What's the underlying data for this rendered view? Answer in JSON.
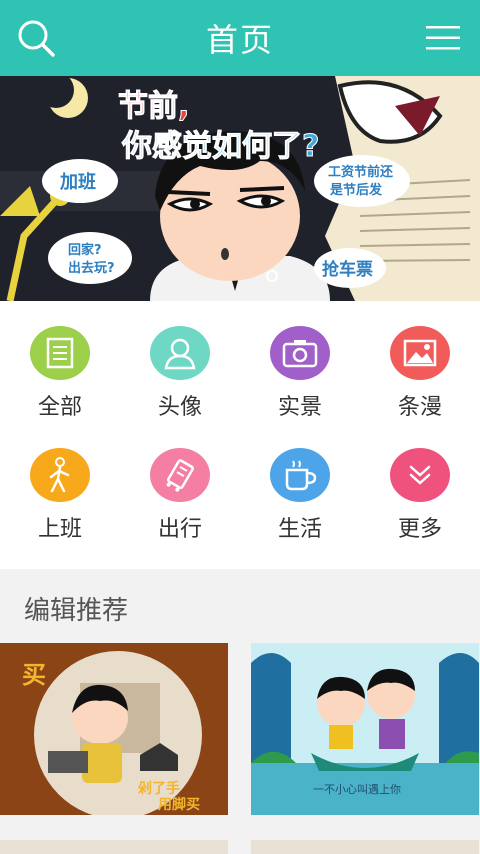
{
  "header": {
    "title": "首页",
    "search_icon": "search-icon",
    "menu_icon": "menu-icon"
  },
  "banner": {
    "headline_1": "节前,",
    "headline_2": "你感觉如何了?",
    "bubble_overtime": "加班",
    "bubble_home_1": "回家?",
    "bubble_home_2": "出去玩?",
    "bubble_salary_1": "工资节前还",
    "bubble_salary_2": "是节后发",
    "bubble_ticket": "抢车票"
  },
  "categories": [
    {
      "label": "全部",
      "icon": "list-icon",
      "color": "#9ccf4a"
    },
    {
      "label": "头像",
      "icon": "person-icon",
      "color": "#6fd8c4"
    },
    {
      "label": "实景",
      "icon": "camera-icon",
      "color": "#a05fc9"
    },
    {
      "label": "条漫",
      "icon": "image-icon",
      "color": "#f15b59"
    },
    {
      "label": "上班",
      "icon": "walking-icon",
      "color": "#f7a81b"
    },
    {
      "label": "出行",
      "icon": "luggage-icon",
      "color": "#f57fa3"
    },
    {
      "label": "生活",
      "icon": "cup-icon",
      "color": "#4da4e8"
    },
    {
      "label": "更多",
      "icon": "chevron-down-icon",
      "color": "#f0527e"
    }
  ],
  "section": {
    "title": "编辑推荐"
  },
  "recommend": [
    {
      "caption_1": "买",
      "caption_2": "剁了手",
      "caption_3": "用脚买"
    },
    {
      "caption_1": "一不小心叫遇上你"
    }
  ]
}
